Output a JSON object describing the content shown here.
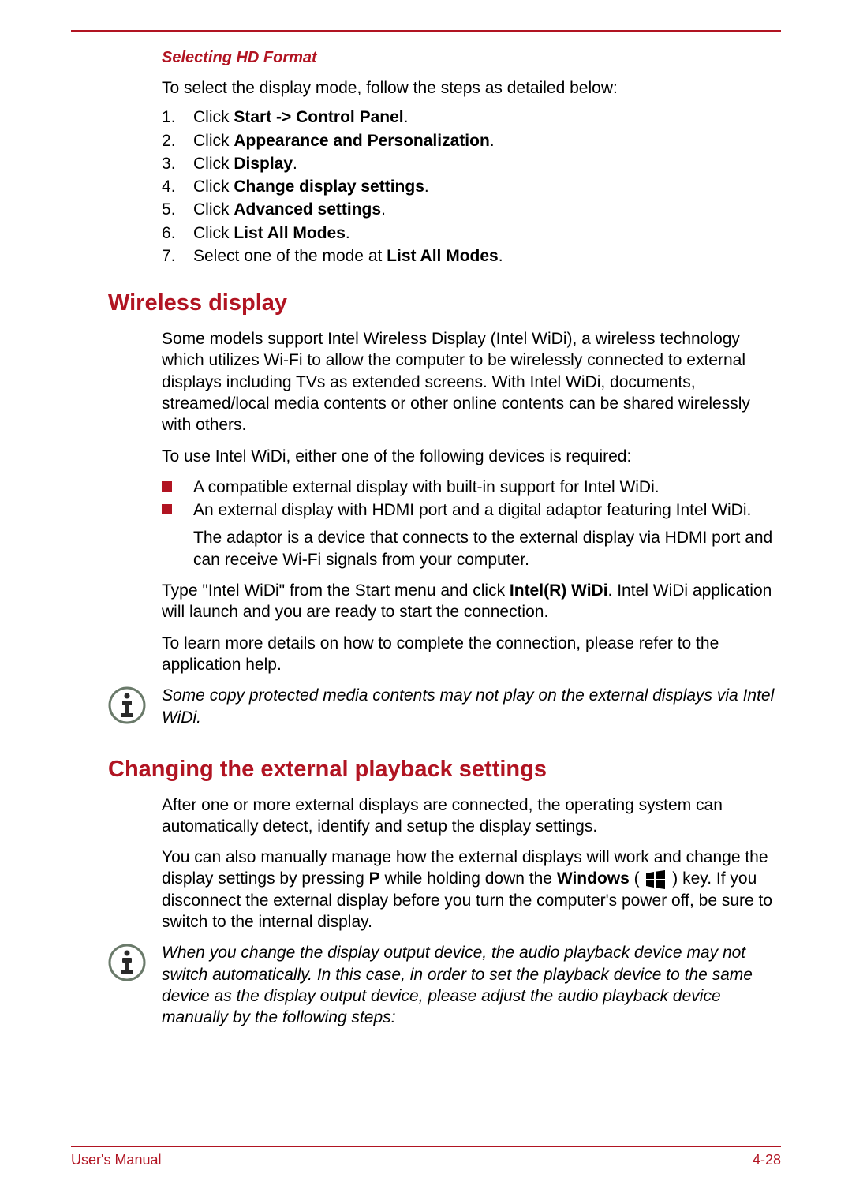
{
  "subheading": "Selecting HD Format",
  "intro": "To select the display mode, follow the steps as detailed below:",
  "steps": [
    {
      "pre": "Click ",
      "bold": "Start -> Control Panel",
      "post": "."
    },
    {
      "pre": "Click ",
      "bold": "Appearance and Personalization",
      "post": "."
    },
    {
      "pre": "Click ",
      "bold": "Display",
      "post": "."
    },
    {
      "pre": "Click ",
      "bold": "Change display settings",
      "post": "."
    },
    {
      "pre": "Click ",
      "bold": "Advanced settings",
      "post": "."
    },
    {
      "pre": "Click ",
      "bold": "List All Modes",
      "post": "."
    },
    {
      "pre": "Select one of the mode at ",
      "bold": "List All Modes",
      "post": "."
    }
  ],
  "h2a": "Wireless display",
  "wireless": {
    "p1": "Some models support Intel Wireless Display (Intel WiDi), a wireless technology which utilizes Wi-Fi to allow the computer to be wirelessly connected to external displays including TVs as extended screens. With Intel WiDi, documents, streamed/local media contents or other online contents can be shared wirelessly with others.",
    "p2": "To use Intel WiDi, either one of the following devices is required:",
    "b1": "A compatible external display with built-in support for Intel WiDi.",
    "b2": "An external display with HDMI port and a digital adaptor featuring Intel WiDi.",
    "b2sub": "The adaptor is a device that connects to the external display via HDMI port and can receive Wi-Fi signals from your computer.",
    "p3a": "Type \"Intel WiDi\" from the Start menu and click ",
    "p3b": "Intel(R) WiDi",
    "p3c": ". Intel WiDi application will launch and you are ready to start the connection.",
    "p4": "To learn more details on how to complete the connection, please refer to the application help.",
    "note": "Some copy protected media contents may not play on the external displays via Intel WiDi."
  },
  "h2b": "Changing the external playback settings",
  "playback": {
    "p1": "After one or more external displays are connected, the operating system can automatically detect, identify and setup the display settings.",
    "p2a": "You can also manually manage how the external displays will work and change the display settings by pressing ",
    "p2b": "P",
    "p2c": " while holding down the ",
    "p2d": "Windows",
    "p2e": " ( ",
    "p2f": " ) key. If you disconnect the external display before you turn the computer's power off, be sure to switch to the internal display.",
    "note": "When you change the display output device, the audio playback device may not switch automatically. In this case, in order to set the playback device to the same device as the display output device, please adjust the audio playback device manually by the following steps:"
  },
  "footer": {
    "left": "User's Manual",
    "right": "4-28"
  },
  "icons": {
    "info": "info-icon",
    "windows": "windows-key-icon"
  }
}
